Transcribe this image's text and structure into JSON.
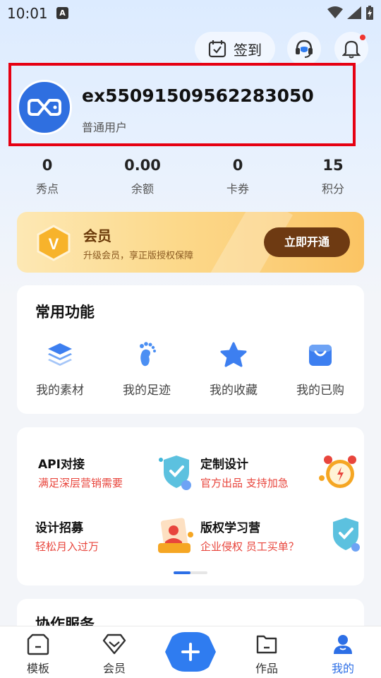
{
  "status_bar": {
    "time": "10:01",
    "a_icon_letter": "A"
  },
  "header": {
    "sign_in_label": "签到"
  },
  "profile": {
    "username": "ex55091509562283050",
    "user_type": "普通用户"
  },
  "stats": [
    {
      "value": "0",
      "label": "秀点"
    },
    {
      "value": "0.00",
      "label": "余额"
    },
    {
      "value": "0",
      "label": "卡券"
    },
    {
      "value": "15",
      "label": "积分"
    }
  ],
  "vip": {
    "title": "会员",
    "subtitle": "升级会员，享正版授权保障",
    "button": "立即开通",
    "badge_letter": "V"
  },
  "functions": {
    "title": "常用功能",
    "items": [
      {
        "label": "我的素材",
        "icon": "layers-icon"
      },
      {
        "label": "我的足迹",
        "icon": "footprint-icon"
      },
      {
        "label": "我的收藏",
        "icon": "star-icon"
      },
      {
        "label": "我的已购",
        "icon": "shopping-bag-icon"
      }
    ]
  },
  "promos": [
    {
      "title": "API对接",
      "subtitle": "满足深层营销需要",
      "icon": "shield-check-icon"
    },
    {
      "title": "定制设计",
      "subtitle": "官方出品 支持加急",
      "icon": "alarm-clock-icon"
    },
    {
      "title": "设计招募",
      "subtitle": "轻松月入过万",
      "icon": "designer-icon"
    },
    {
      "title": "版权学习营",
      "subtitle": "企业侵权 员工买单？",
      "icon": "shield-check-icon"
    }
  ],
  "carousel": {
    "active_index": 0,
    "pages": 2
  },
  "collab": {
    "title": "协作服务"
  },
  "bottom_nav": [
    {
      "label": "模板",
      "icon": "template-icon",
      "active": false
    },
    {
      "label": "会员",
      "icon": "diamond-icon",
      "active": false
    },
    {
      "label": "作品",
      "icon": "folder-icon",
      "active": false
    },
    {
      "label": "我的",
      "icon": "user-icon",
      "active": true
    }
  ],
  "colors": {
    "accent": "#2d6fe6",
    "highlight_border": "#e60012",
    "vip_button": "#6e3a12",
    "promo_subtitle": "#e8453c"
  }
}
